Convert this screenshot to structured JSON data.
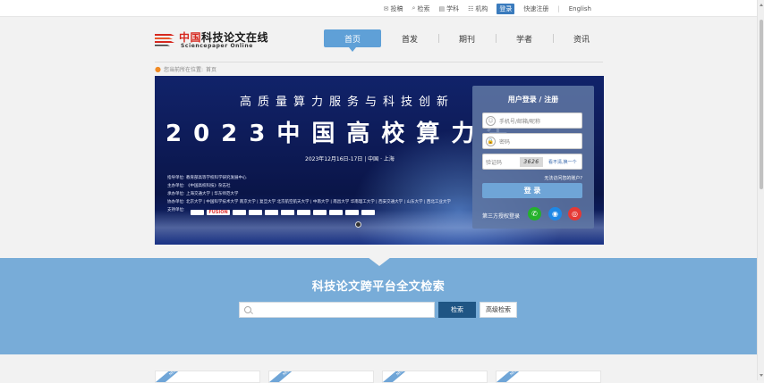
{
  "colors": {
    "accent": "#5fa0d7",
    "search_band": "#78acd8",
    "search_button": "#1f5584",
    "logo_red": "#d6281f"
  },
  "topnav": {
    "submit": {
      "icon": "submit-icon",
      "label": "投稿"
    },
    "search": {
      "icon": "search-icon",
      "label": "检索"
    },
    "subject": {
      "icon": "subject-icon",
      "label": "学科"
    },
    "institution": {
      "icon": "institution-icon",
      "label": "机构"
    },
    "login": "登录",
    "register": "快速注册",
    "separator": "|",
    "english": "English"
  },
  "logo": {
    "cn_red": "中国",
    "cn_rest": "科技论文在线",
    "en": "Sciencepaper Online"
  },
  "mainnav": [
    {
      "label": "首页",
      "active": true
    },
    {
      "label": "首发",
      "active": false
    },
    {
      "label": "期刊",
      "active": false
    },
    {
      "label": "学者",
      "active": false
    },
    {
      "label": "资讯",
      "active": false
    }
  ],
  "breadcrumb": {
    "prefix": "您当前所在位置:",
    "current": "首页"
  },
  "banner": {
    "line1": "高质量算力服务与科技创新",
    "line2": "2023中国高校算力生",
    "date": "2023年12月16日-17日  |  中国 · 上海",
    "orgs": [
      "指导单位:    教育部高等学校科学研究发展中心",
      "主办单位:    《中国高校科技》杂志社",
      "承办单位:    上海交通大学 | 华东师范大学",
      "协办单位:    北京大学 | 中国科学技术大学   南京大学 | 复旦大学   北京航空航天大学 | 中南大学 | 南昌大学   华南理工大学 | 西安交通大学 | 山东大学 | 西北工业大学",
      "支持单位:"
    ],
    "sponsor_logo": "FUSION"
  },
  "login": {
    "title": "用户登录 / 注册",
    "account_placeholder": "手机号/邮箱/昵称",
    "password_placeholder": "密码",
    "captcha_placeholder": "验证码",
    "captcha_image": "3626",
    "refresh": "看不清,换一个",
    "forgot": "无法访问您的账户?",
    "submit": "登 录",
    "third_party": "第三方授权登录"
  },
  "search": {
    "title": "科技论文跨平台全文检索",
    "placeholder": "",
    "button": "检索",
    "advanced": "高级检索"
  },
  "cards": [
    {
      "tag": "NEW"
    },
    {
      "tag": "NEW"
    },
    {
      "tag": "NEW"
    },
    {
      "tag": "NEW"
    }
  ]
}
